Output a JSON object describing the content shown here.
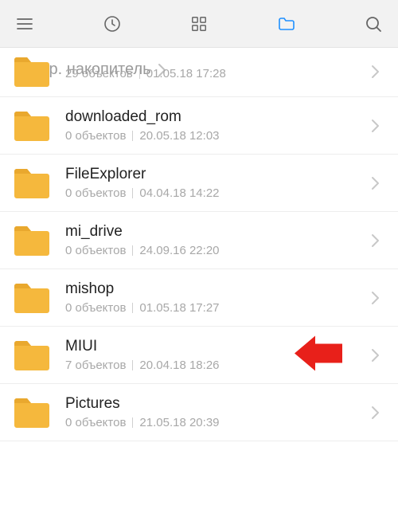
{
  "breadcrumb": {
    "label": "Внутр. накопитель"
  },
  "items": [
    {
      "name": "",
      "count": "29 объектов",
      "date": "01.05.18 17:28",
      "partial": true
    },
    {
      "name": "downloaded_rom",
      "count": "0 объектов",
      "date": "20.05.18 12:03"
    },
    {
      "name": "FileExplorer",
      "count": "0 объектов",
      "date": "04.04.18 14:22"
    },
    {
      "name": "mi_drive",
      "count": "0 объектов",
      "date": "24.09.16 22:20"
    },
    {
      "name": "mishop",
      "count": "0 объектов",
      "date": "01.05.18 17:27"
    },
    {
      "name": "MIUI",
      "count": "7 объектов",
      "date": "20.04.18 18:26",
      "highlighted": true
    },
    {
      "name": "Pictures",
      "count": "0 объектов",
      "date": "21.05.18 20:39"
    }
  ]
}
